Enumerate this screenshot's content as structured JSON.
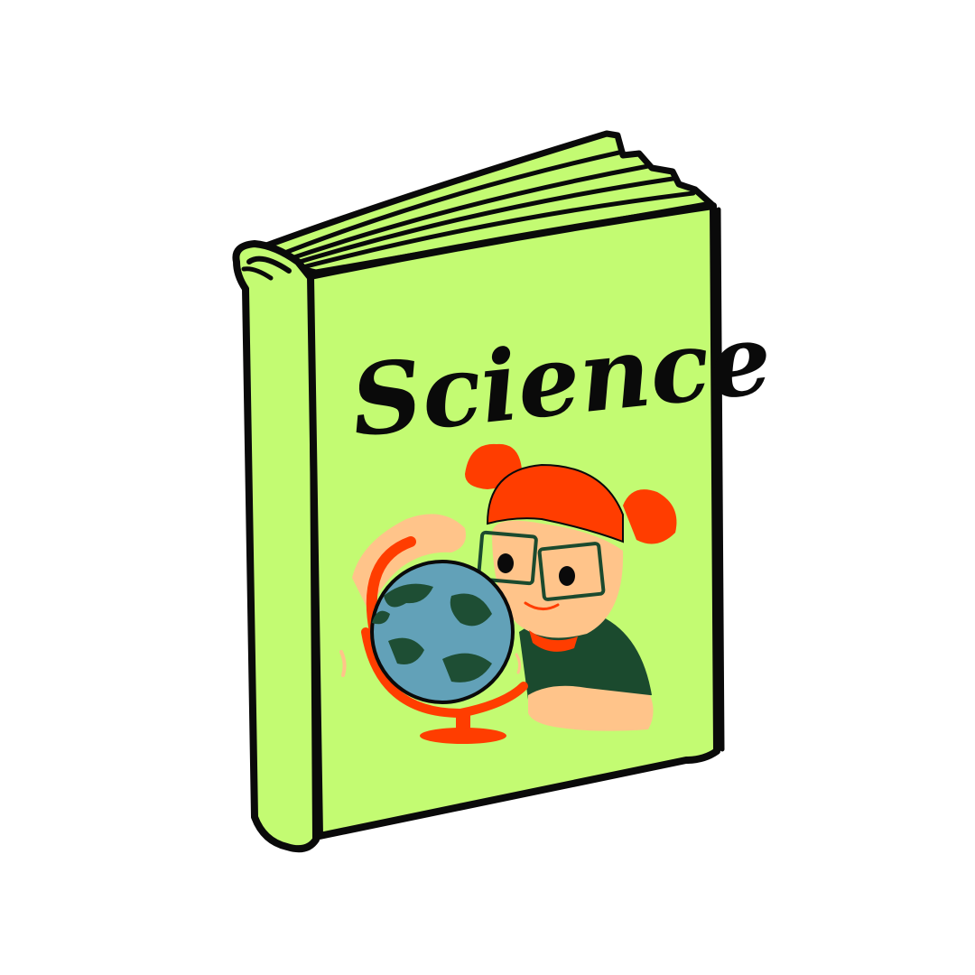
{
  "cover": {
    "title": "Science"
  },
  "colors": {
    "book_green": "#c3fb72",
    "outline": "#0a0a0a",
    "hair_orange": "#ff3d00",
    "skin": "#ffc48a",
    "shirt_dark_green": "#1b4a2e",
    "globe_blue": "#62a1b8",
    "globe_land": "#1e4e34",
    "background": "#ffffff"
  },
  "icons": {
    "illustration": "girl-with-globe-illustration",
    "book": "book-icon"
  }
}
